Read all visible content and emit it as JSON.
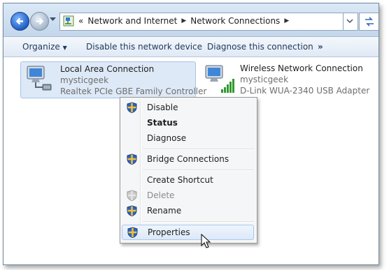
{
  "address_bar": {
    "overflow_chevron": "«",
    "crumbs": [
      "Network and Internet",
      "Network Connections"
    ],
    "icons": [
      "back-icon",
      "forward-icon",
      "recent-pages-dropdown-icon",
      "network-location-icon",
      "refresh-icon"
    ]
  },
  "toolbar": {
    "organize": "Organize",
    "disable": "Disable this network device",
    "diagnose": "Diagnose this connection",
    "more": "»"
  },
  "connections": [
    {
      "name": "Local Area Connection",
      "network": "mysticgeek",
      "adapter": "Realtek PCIe GBE Family Controller",
      "selected": true,
      "icon": "wired-network-icon"
    },
    {
      "name": "Wireless Network Connection",
      "network": "mysticgeek",
      "adapter": "D-Link WUA-2340 USB Adapter",
      "selected": false,
      "icon": "wireless-network-icon"
    }
  ],
  "context_menu": {
    "items": [
      {
        "label": "Disable",
        "shield": true
      },
      {
        "label": "Status",
        "bold": true
      },
      {
        "label": "Diagnose"
      },
      {
        "label": "Bridge Connections",
        "shield": true
      },
      {
        "label": "Create Shortcut"
      },
      {
        "label": "Delete",
        "shield": true,
        "disabled": true
      },
      {
        "label": "Rename",
        "shield": true
      },
      {
        "label": "Properties",
        "shield": true,
        "highlighted": true
      }
    ]
  },
  "colors": {
    "accent": "#1f5fc4",
    "selection": "#dde9f7",
    "toolbar_text": "#1e395b",
    "secondary_text": "#6d6d6d"
  }
}
